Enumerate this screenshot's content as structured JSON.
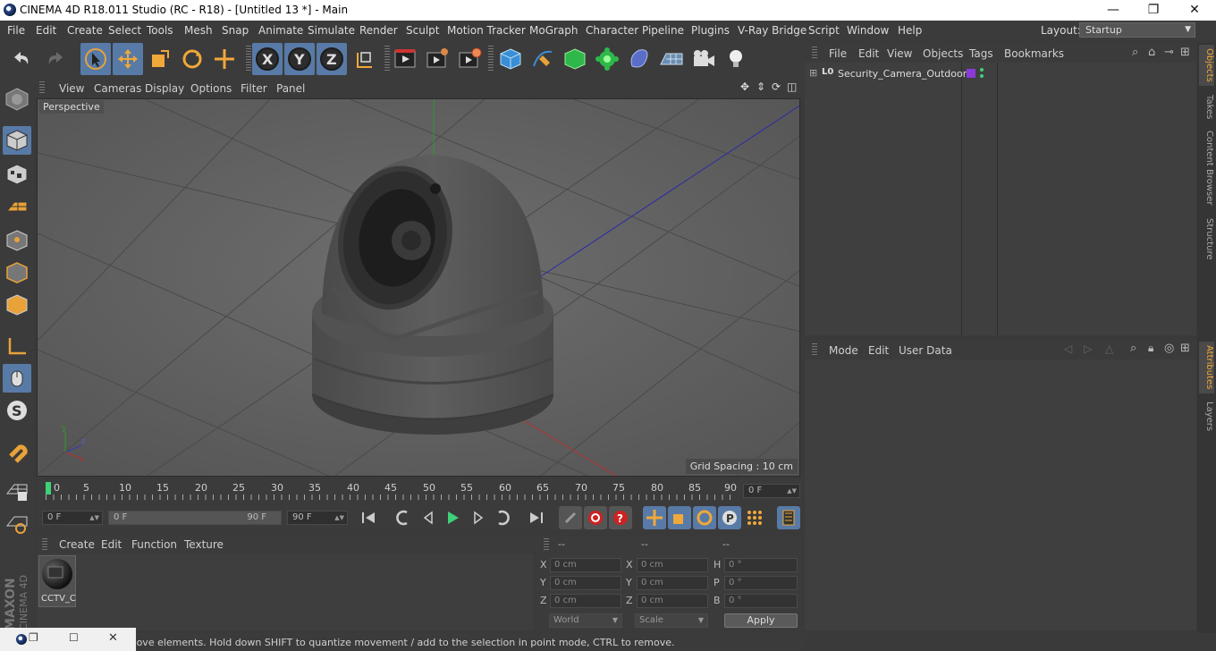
{
  "window": {
    "title": "CINEMA 4D R18.011 Studio (RC - R18) - [Untitled 13 *] - Main",
    "minimize": "—",
    "restore": "❐",
    "close": "✕"
  },
  "menubar": {
    "items": [
      "File",
      "Edit",
      "Create",
      "Select",
      "Tools",
      "Mesh",
      "Snap",
      "Animate",
      "Simulate",
      "Render",
      "Sculpt",
      "Motion Tracker",
      "MoGraph",
      "Character",
      "Pipeline",
      "Plugins",
      "V-Ray Bridge",
      "Script",
      "Window",
      "Help"
    ],
    "layout_label": "Layout:",
    "layout_value": "Startup"
  },
  "viewport": {
    "menu": [
      "View",
      "Cameras",
      "Display",
      "Options",
      "Filter",
      "Panel"
    ],
    "label": "Perspective",
    "grid_spacing": "Grid Spacing : 10 cm"
  },
  "timeline": {
    "ticks": [
      "0",
      "5",
      "10",
      "15",
      "20",
      "25",
      "30",
      "35",
      "40",
      "45",
      "50",
      "55",
      "60",
      "65",
      "70",
      "75",
      "80",
      "85",
      "90"
    ],
    "current_frame": "0 F"
  },
  "time_controls": {
    "start": "0 F",
    "range_start": "0 F",
    "range_end": "90 F",
    "end": "90 F"
  },
  "material_manager": {
    "menu": [
      "Create",
      "Edit",
      "Function",
      "Texture"
    ],
    "materials": [
      {
        "name": "CCTV_C"
      }
    ]
  },
  "coordinates": {
    "headers": [
      "--",
      "--",
      "--"
    ],
    "rows": [
      {
        "a": "X",
        "av": "0 cm",
        "b": "X",
        "bv": "0 cm",
        "c": "H",
        "cv": "0 °"
      },
      {
        "a": "Y",
        "av": "0 cm",
        "b": "Y",
        "bv": "0 cm",
        "c": "P",
        "cv": "0 °"
      },
      {
        "a": "Z",
        "av": "0 cm",
        "b": "Z",
        "bv": "0 cm",
        "c": "B",
        "cv": "0 °"
      }
    ],
    "world": "World",
    "scale": "Scale",
    "apply": "Apply"
  },
  "object_manager": {
    "menu": [
      "File",
      "Edit",
      "View",
      "Objects",
      "Tags",
      "Bookmarks"
    ],
    "objects": [
      {
        "name": "Security_Camera_Outdoor",
        "layer": "L0"
      }
    ]
  },
  "attribute_manager": {
    "menu": [
      "Mode",
      "Edit",
      "User Data"
    ]
  },
  "right_tabs": [
    "Objects",
    "Takes",
    "Content Browser",
    "Structure",
    "Attributes",
    "Layers"
  ],
  "status": "Move: Click and drag to move elements. Hold down SHIFT to quantize movement / add to the selection in point mode, CTRL to remove.",
  "branding": {
    "maxon": "MAXON",
    "product": "CINEMA 4D"
  },
  "colors": {
    "accent": "#587aa6",
    "panel": "#3b3b3b",
    "viewport": "#5c5c5c",
    "timeline_marker": "#3fd17a"
  }
}
